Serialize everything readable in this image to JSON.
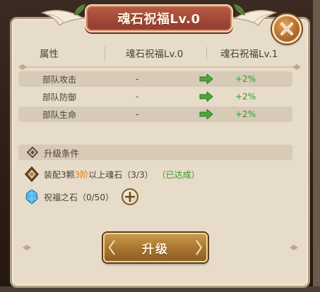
{
  "title": "魂石祝福Lv.0",
  "table": {
    "headers": [
      "属性",
      "魂石祝福Lv.0",
      "魂石祝福Lv.1"
    ],
    "rows": [
      {
        "name": "部队攻击",
        "current": "-",
        "next": "+2%"
      },
      {
        "name": "部队防御",
        "current": "-",
        "next": "+2%"
      },
      {
        "name": "部队生命",
        "current": "-",
        "next": "+2%"
      }
    ]
  },
  "conditions": {
    "header": "升级条件",
    "requirement": {
      "prefix": "装配3颗",
      "highlight": "3阶",
      "suffix": "以上魂石（3/3）",
      "status": "（已达成）"
    },
    "material": {
      "label": "祝福之石（0/50）"
    }
  },
  "upgrade_button": "升级",
  "colors": {
    "title_banner": "#a84a38",
    "positive": "#2e9a2a",
    "highlight": "#e07a1c",
    "button": "#a87330"
  },
  "icons": {
    "close": "close-x-icon",
    "arrow": "green-arrow-right-icon",
    "condition": "diamond-rune-icon",
    "soulstone": "soulstone-icon",
    "blessing_stone": "blue-crystal-icon",
    "add": "plus-icon"
  }
}
